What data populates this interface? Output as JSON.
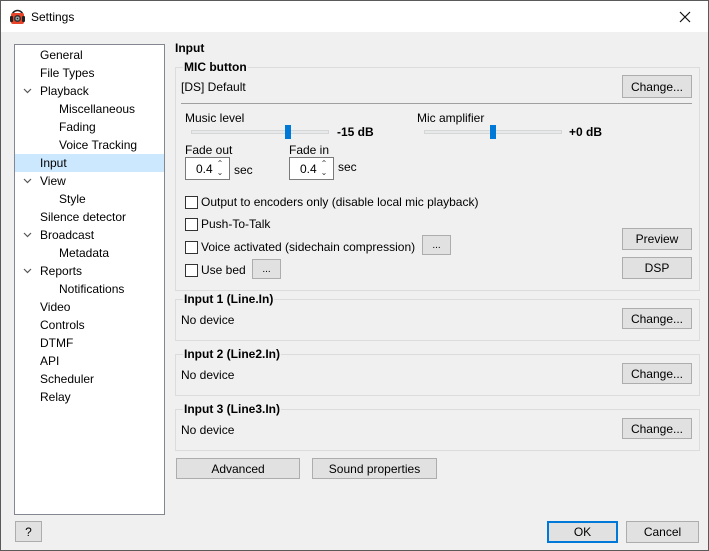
{
  "window": {
    "title": "Settings",
    "app_icon": "headphones-speaker-icon",
    "close_icon": "close-icon"
  },
  "sidebar": {
    "items": [
      {
        "label": "General",
        "level": 0,
        "expandable": false,
        "selected": false
      },
      {
        "label": "File Types",
        "level": 0,
        "expandable": false,
        "selected": false
      },
      {
        "label": "Playback",
        "level": 0,
        "expandable": true,
        "selected": false
      },
      {
        "label": "Miscellaneous",
        "level": 1,
        "expandable": false,
        "selected": false
      },
      {
        "label": "Fading",
        "level": 1,
        "expandable": false,
        "selected": false
      },
      {
        "label": "Voice Tracking",
        "level": 1,
        "expandable": false,
        "selected": false
      },
      {
        "label": "Input",
        "level": 0,
        "expandable": false,
        "selected": true
      },
      {
        "label": "View",
        "level": 0,
        "expandable": true,
        "selected": false
      },
      {
        "label": "Style",
        "level": 1,
        "expandable": false,
        "selected": false
      },
      {
        "label": "Silence detector",
        "level": 0,
        "expandable": false,
        "selected": false
      },
      {
        "label": "Broadcast",
        "level": 0,
        "expandable": true,
        "selected": false
      },
      {
        "label": "Metadata",
        "level": 1,
        "expandable": false,
        "selected": false
      },
      {
        "label": "Reports",
        "level": 0,
        "expandable": true,
        "selected": false
      },
      {
        "label": "Notifications",
        "level": 1,
        "expandable": false,
        "selected": false
      },
      {
        "label": "Video",
        "level": 0,
        "expandable": false,
        "selected": false
      },
      {
        "label": "Controls",
        "level": 0,
        "expandable": false,
        "selected": false
      },
      {
        "label": "DTMF",
        "level": 0,
        "expandable": false,
        "selected": false
      },
      {
        "label": "API",
        "level": 0,
        "expandable": false,
        "selected": false
      },
      {
        "label": "Scheduler",
        "level": 0,
        "expandable": false,
        "selected": false
      },
      {
        "label": "Relay",
        "level": 0,
        "expandable": false,
        "selected": false
      }
    ],
    "chevron_glyph": "⌄"
  },
  "main": {
    "title": "Input",
    "mic": {
      "legend": "MIC button",
      "device": "[DS] Default",
      "change_label": "Change...",
      "music_level_label": "Music level",
      "music_level_value": "-15 dB",
      "music_level_fraction": 0.7,
      "mic_amp_label": "Mic amplifier",
      "mic_amp_value": "+0 dB",
      "mic_amp_fraction": 0.5,
      "fade_out_label": "Fade out",
      "fade_out_value": "0.4",
      "fade_in_label": "Fade in",
      "fade_in_value": "0.4",
      "sec_label": "sec",
      "spin_arrows": "⌃⌄",
      "checkboxes": [
        {
          "label": "Output to encoders only (disable local mic playback)",
          "checked": false
        },
        {
          "label": "Push-To-Talk",
          "checked": false
        },
        {
          "label": "Voice activated (sidechain compression)",
          "checked": false
        },
        {
          "label": "Use bed",
          "checked": false
        }
      ],
      "ellipsis_label": "...",
      "preview_label": "Preview",
      "dsp_label": "DSP"
    },
    "inputs": [
      {
        "legend": "Input 1 (Line.In)",
        "device": "No device",
        "change_label": "Change..."
      },
      {
        "legend": "Input 2 (Line2.In)",
        "device": "No device",
        "change_label": "Change..."
      },
      {
        "legend": "Input 3 (Line3.In)",
        "device": "No device",
        "change_label": "Change..."
      }
    ],
    "advanced_label": "Advanced",
    "sound_properties_label": "Sound properties"
  },
  "footer": {
    "help_label": "?",
    "ok_label": "OK",
    "cancel_label": "Cancel"
  }
}
